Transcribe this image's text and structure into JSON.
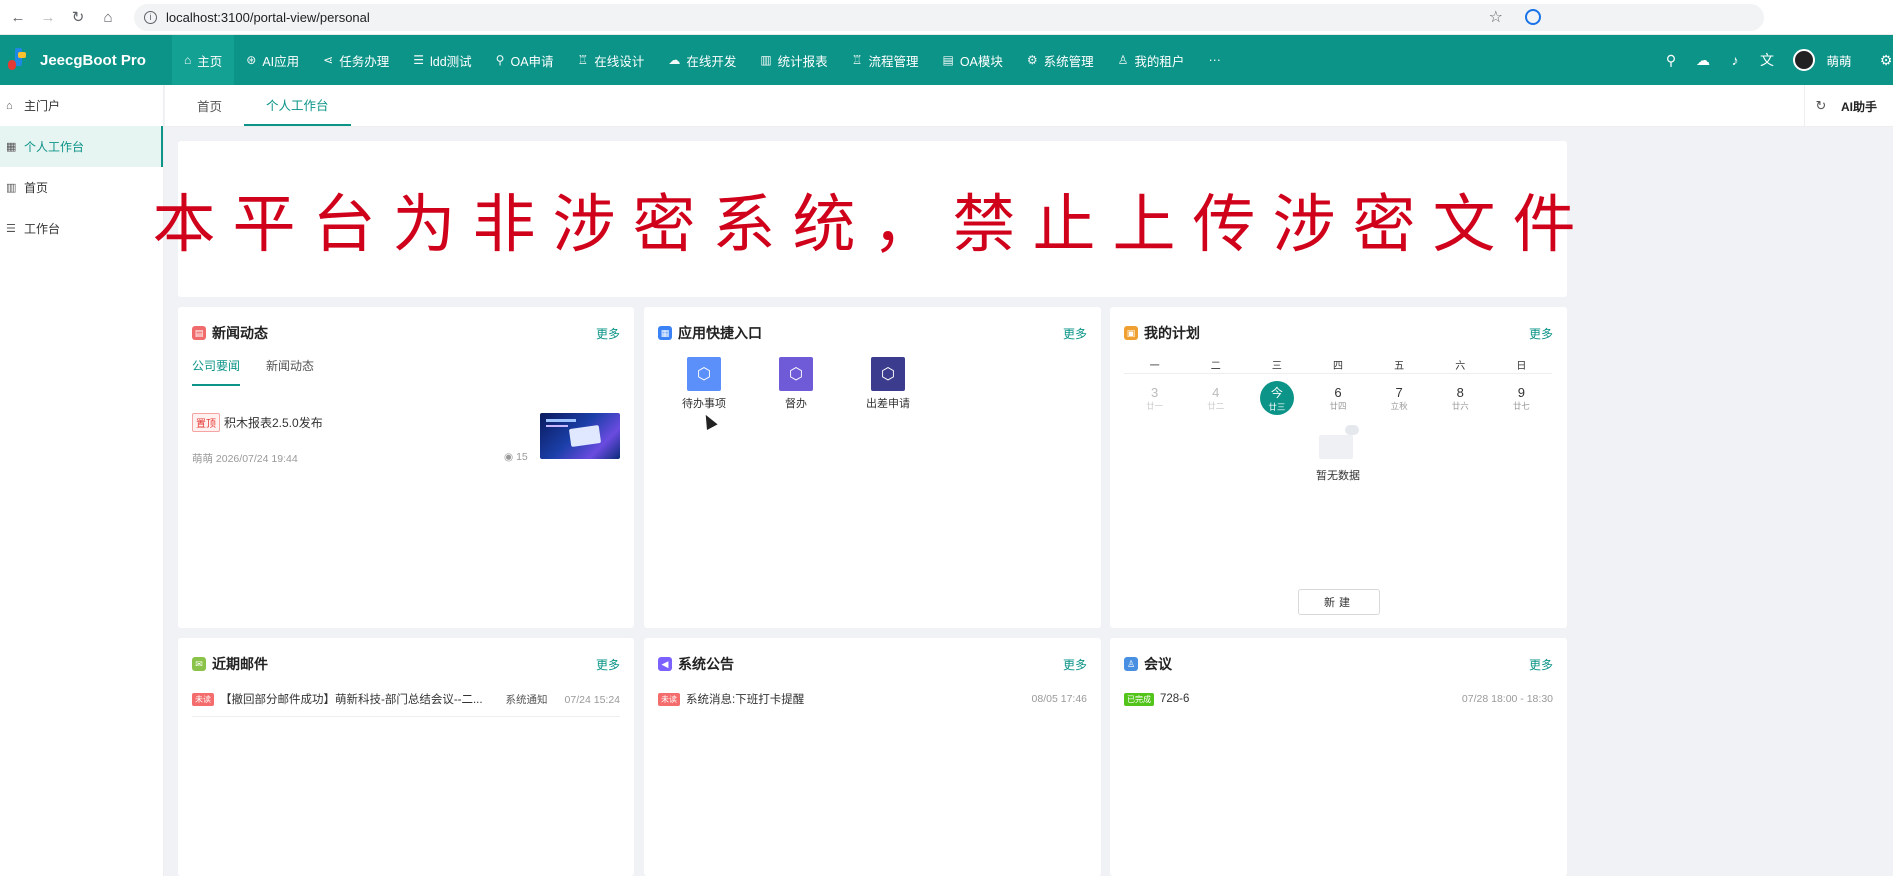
{
  "browser": {
    "url": "localhost:3100/portal-view/personal"
  },
  "app": {
    "title": "JeecgBoot Pro"
  },
  "topnav": {
    "items": [
      {
        "label": "主页",
        "icon": "home-icon",
        "glyph": "⌂"
      },
      {
        "label": "AI应用",
        "icon": "ai-icon",
        "glyph": "⊛"
      },
      {
        "label": "任务办理",
        "icon": "share-icon",
        "glyph": "⋖"
      },
      {
        "label": "ldd测试",
        "icon": "list-icon",
        "glyph": "☰"
      },
      {
        "label": "OA申请",
        "icon": "user-icon",
        "glyph": "⚲"
      },
      {
        "label": "在线设计",
        "icon": "org-icon",
        "glyph": "♖"
      },
      {
        "label": "在线开发",
        "icon": "cloud-icon",
        "glyph": "☁"
      },
      {
        "label": "统计报表",
        "icon": "chart-icon",
        "glyph": "▥"
      },
      {
        "label": "流程管理",
        "icon": "flow-icon",
        "glyph": "♖"
      },
      {
        "label": "OA模块",
        "icon": "doc-icon",
        "glyph": "▤"
      },
      {
        "label": "系统管理",
        "icon": "gear-icon",
        "glyph": "⚙"
      },
      {
        "label": "我的租户",
        "icon": "person-icon",
        "glyph": "♙"
      },
      {
        "label": "···",
        "icon": "more-icon",
        "glyph": ""
      }
    ],
    "user": "萌萌"
  },
  "sidebar": {
    "items": [
      {
        "label": "主门户",
        "glyph": "⌂"
      },
      {
        "label": "个人工作台",
        "glyph": "▦"
      },
      {
        "label": "首页",
        "glyph": "▥"
      },
      {
        "label": "工作台",
        "glyph": "☰"
      }
    ]
  },
  "tabs": {
    "items": [
      "首页",
      "个人工作台"
    ],
    "ai": "AI助手"
  },
  "banner": {
    "text": "本平台为非涉密系统，禁止上传涉密文件"
  },
  "news": {
    "title": "新闻动态",
    "more": "更多",
    "tabs": [
      "公司要闻",
      "新闻动态"
    ],
    "item": {
      "tag": "置顶",
      "title": "积木报表2.5.0发布",
      "meta": "萌萌  2026/07/24 19:44",
      "views": "15"
    }
  },
  "apps": {
    "title": "应用快捷入口",
    "more": "更多",
    "items": [
      {
        "label": "待办事项",
        "color": "#5b8ff9"
      },
      {
        "label": "督办",
        "color": "#6f5ad8"
      },
      {
        "label": "出差申请",
        "color": "#3c3c8f"
      }
    ]
  },
  "plan": {
    "title": "我的计划",
    "more": "更多",
    "weekdays": [
      "一",
      "二",
      "三",
      "四",
      "五",
      "六",
      "日"
    ],
    "days": [
      {
        "n": "3",
        "l": "廿一",
        "state": "past"
      },
      {
        "n": "4",
        "l": "廿二",
        "state": "past"
      },
      {
        "n": "今",
        "l": "廿三",
        "state": "today"
      },
      {
        "n": "6",
        "l": "廿四",
        "state": ""
      },
      {
        "n": "7",
        "l": "立秋",
        "state": ""
      },
      {
        "n": "8",
        "l": "廿六",
        "state": ""
      },
      {
        "n": "9",
        "l": "廿七",
        "state": ""
      }
    ],
    "empty": "暂无数据",
    "new": "新建"
  },
  "mail": {
    "title": "近期邮件",
    "more": "更多",
    "badge": "未读",
    "subject": "【撤回部分邮件成功】萌新科技-部门总结会议--二...",
    "category": "系统通知",
    "time": "07/24 15:24"
  },
  "notice": {
    "title": "系统公告",
    "more": "更多",
    "badge": "未读",
    "subject": "系统消息:下班打卡提醒",
    "time": "08/05 17:46"
  },
  "meeting": {
    "title": "会议",
    "more": "更多",
    "badge": "已完成",
    "subject": "728-6",
    "time": "07/28 18:00 - 18:30"
  },
  "colors": {
    "primary": "#0c9488",
    "banner": "#d0021b"
  }
}
